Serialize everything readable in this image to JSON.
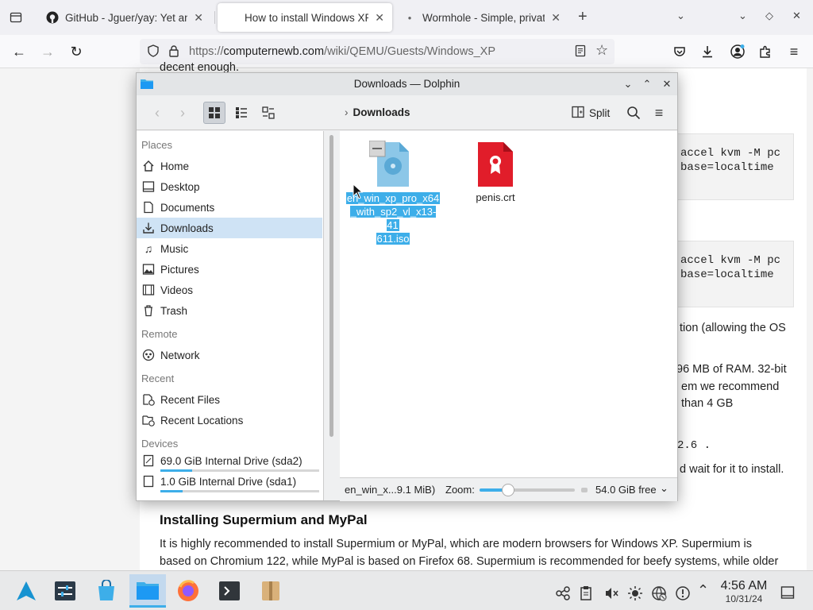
{
  "browser": {
    "tabs": [
      {
        "title": "GitHub - Jguer/yay: Yet an"
      },
      {
        "title": "How to install Windows XP"
      },
      {
        "title": "Wormhole - Simple, privat"
      }
    ],
    "url": {
      "scheme": "https://",
      "host": "computernewb.com",
      "path": "/wiki/QEMU/Guests/Windows_XP"
    }
  },
  "webpage": {
    "top_fragment": "decent enough.",
    "code_blocks": [
      {
        "line1": "accel kvm -M pc",
        "line2": "base=localtime"
      },
      {
        "line1": "accel kvm -M pc",
        "line2": "base=localtime"
      }
    ],
    "fragments": {
      "f1": "tion (allowing the OS",
      "f2": "96 MB of RAM. 32-bit",
      "f3": "em we recommend",
      "f4": "than 4 GB",
      "f5": "2.6 .",
      "f6": "d wait for it to install."
    },
    "heading": "Installing Supermium and MyPal",
    "paragraph_lines": [
      "It is highly recommended to install Supermium or MyPal, which are modern browsers for Windows XP. Supermium is",
      "based on Chromium 122, while MyPal is based on Firefox 68. Supermium is recommended for beefy systems, while older"
    ]
  },
  "dolphin": {
    "title": "Downloads — Dolphin",
    "breadcrumb": "Downloads",
    "split_label": "Split",
    "places": {
      "places_header": "Places",
      "items": [
        {
          "label": "Home",
          "icon": "home-icon"
        },
        {
          "label": "Desktop",
          "icon": "desktop-icon"
        },
        {
          "label": "Documents",
          "icon": "documents-icon"
        },
        {
          "label": "Downloads",
          "icon": "downloads-icon"
        },
        {
          "label": "Music",
          "icon": "music-icon"
        },
        {
          "label": "Pictures",
          "icon": "pictures-icon"
        },
        {
          "label": "Videos",
          "icon": "videos-icon"
        },
        {
          "label": "Trash",
          "icon": "trash-icon"
        }
      ],
      "remote_header": "Remote",
      "remote_items": [
        {
          "label": "Network",
          "icon": "network-icon"
        }
      ],
      "recent_header": "Recent",
      "recent_items": [
        {
          "label": "Recent Files",
          "icon": "recent-files-icon"
        },
        {
          "label": "Recent Locations",
          "icon": "recent-locations-icon"
        }
      ],
      "devices_header": "Devices",
      "devices": [
        {
          "label": "69.0 GiB Internal Drive (sda2)",
          "used_fraction": 0.2
        },
        {
          "label": "1.0 GiB Internal Drive (sda1)",
          "used_fraction": 0.14
        }
      ]
    },
    "files": [
      {
        "name_lines": [
          "en_win_xp_pro_x64",
          "_with_sp2_vl_x13-41",
          "611.iso"
        ],
        "type": "iso",
        "selected": true
      },
      {
        "name_lines": [
          "penis.crt"
        ],
        "type": "certificate",
        "selected": false
      }
    ],
    "status": {
      "selection": "en_win_x...9.1 MiB)",
      "zoom_label": "Zoom:",
      "zoom_fraction": 0.3,
      "free_space": "54.0 GiB free"
    }
  },
  "taskbar": {
    "clock_time": "4:56 AM",
    "clock_date": "10/31/24"
  }
}
